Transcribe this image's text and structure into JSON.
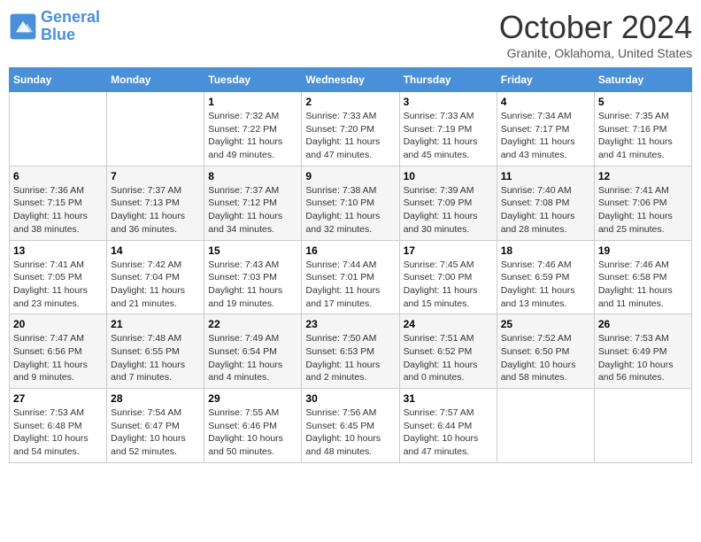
{
  "logo": {
    "line1": "General",
    "line2": "Blue"
  },
  "title": "October 2024",
  "location": "Granite, Oklahoma, United States",
  "days_header": [
    "Sunday",
    "Monday",
    "Tuesday",
    "Wednesday",
    "Thursday",
    "Friday",
    "Saturday"
  ],
  "weeks": [
    [
      {
        "num": "",
        "info": ""
      },
      {
        "num": "",
        "info": ""
      },
      {
        "num": "1",
        "info": "Sunrise: 7:32 AM\nSunset: 7:22 PM\nDaylight: 11 hours and 49 minutes."
      },
      {
        "num": "2",
        "info": "Sunrise: 7:33 AM\nSunset: 7:20 PM\nDaylight: 11 hours and 47 minutes."
      },
      {
        "num": "3",
        "info": "Sunrise: 7:33 AM\nSunset: 7:19 PM\nDaylight: 11 hours and 45 minutes."
      },
      {
        "num": "4",
        "info": "Sunrise: 7:34 AM\nSunset: 7:17 PM\nDaylight: 11 hours and 43 minutes."
      },
      {
        "num": "5",
        "info": "Sunrise: 7:35 AM\nSunset: 7:16 PM\nDaylight: 11 hours and 41 minutes."
      }
    ],
    [
      {
        "num": "6",
        "info": "Sunrise: 7:36 AM\nSunset: 7:15 PM\nDaylight: 11 hours and 38 minutes."
      },
      {
        "num": "7",
        "info": "Sunrise: 7:37 AM\nSunset: 7:13 PM\nDaylight: 11 hours and 36 minutes."
      },
      {
        "num": "8",
        "info": "Sunrise: 7:37 AM\nSunset: 7:12 PM\nDaylight: 11 hours and 34 minutes."
      },
      {
        "num": "9",
        "info": "Sunrise: 7:38 AM\nSunset: 7:10 PM\nDaylight: 11 hours and 32 minutes."
      },
      {
        "num": "10",
        "info": "Sunrise: 7:39 AM\nSunset: 7:09 PM\nDaylight: 11 hours and 30 minutes."
      },
      {
        "num": "11",
        "info": "Sunrise: 7:40 AM\nSunset: 7:08 PM\nDaylight: 11 hours and 28 minutes."
      },
      {
        "num": "12",
        "info": "Sunrise: 7:41 AM\nSunset: 7:06 PM\nDaylight: 11 hours and 25 minutes."
      }
    ],
    [
      {
        "num": "13",
        "info": "Sunrise: 7:41 AM\nSunset: 7:05 PM\nDaylight: 11 hours and 23 minutes."
      },
      {
        "num": "14",
        "info": "Sunrise: 7:42 AM\nSunset: 7:04 PM\nDaylight: 11 hours and 21 minutes."
      },
      {
        "num": "15",
        "info": "Sunrise: 7:43 AM\nSunset: 7:03 PM\nDaylight: 11 hours and 19 minutes."
      },
      {
        "num": "16",
        "info": "Sunrise: 7:44 AM\nSunset: 7:01 PM\nDaylight: 11 hours and 17 minutes."
      },
      {
        "num": "17",
        "info": "Sunrise: 7:45 AM\nSunset: 7:00 PM\nDaylight: 11 hours and 15 minutes."
      },
      {
        "num": "18",
        "info": "Sunrise: 7:46 AM\nSunset: 6:59 PM\nDaylight: 11 hours and 13 minutes."
      },
      {
        "num": "19",
        "info": "Sunrise: 7:46 AM\nSunset: 6:58 PM\nDaylight: 11 hours and 11 minutes."
      }
    ],
    [
      {
        "num": "20",
        "info": "Sunrise: 7:47 AM\nSunset: 6:56 PM\nDaylight: 11 hours and 9 minutes."
      },
      {
        "num": "21",
        "info": "Sunrise: 7:48 AM\nSunset: 6:55 PM\nDaylight: 11 hours and 7 minutes."
      },
      {
        "num": "22",
        "info": "Sunrise: 7:49 AM\nSunset: 6:54 PM\nDaylight: 11 hours and 4 minutes."
      },
      {
        "num": "23",
        "info": "Sunrise: 7:50 AM\nSunset: 6:53 PM\nDaylight: 11 hours and 2 minutes."
      },
      {
        "num": "24",
        "info": "Sunrise: 7:51 AM\nSunset: 6:52 PM\nDaylight: 11 hours and 0 minutes."
      },
      {
        "num": "25",
        "info": "Sunrise: 7:52 AM\nSunset: 6:50 PM\nDaylight: 10 hours and 58 minutes."
      },
      {
        "num": "26",
        "info": "Sunrise: 7:53 AM\nSunset: 6:49 PM\nDaylight: 10 hours and 56 minutes."
      }
    ],
    [
      {
        "num": "27",
        "info": "Sunrise: 7:53 AM\nSunset: 6:48 PM\nDaylight: 10 hours and 54 minutes."
      },
      {
        "num": "28",
        "info": "Sunrise: 7:54 AM\nSunset: 6:47 PM\nDaylight: 10 hours and 52 minutes."
      },
      {
        "num": "29",
        "info": "Sunrise: 7:55 AM\nSunset: 6:46 PM\nDaylight: 10 hours and 50 minutes."
      },
      {
        "num": "30",
        "info": "Sunrise: 7:56 AM\nSunset: 6:45 PM\nDaylight: 10 hours and 48 minutes."
      },
      {
        "num": "31",
        "info": "Sunrise: 7:57 AM\nSunset: 6:44 PM\nDaylight: 10 hours and 47 minutes."
      },
      {
        "num": "",
        "info": ""
      },
      {
        "num": "",
        "info": ""
      }
    ]
  ]
}
